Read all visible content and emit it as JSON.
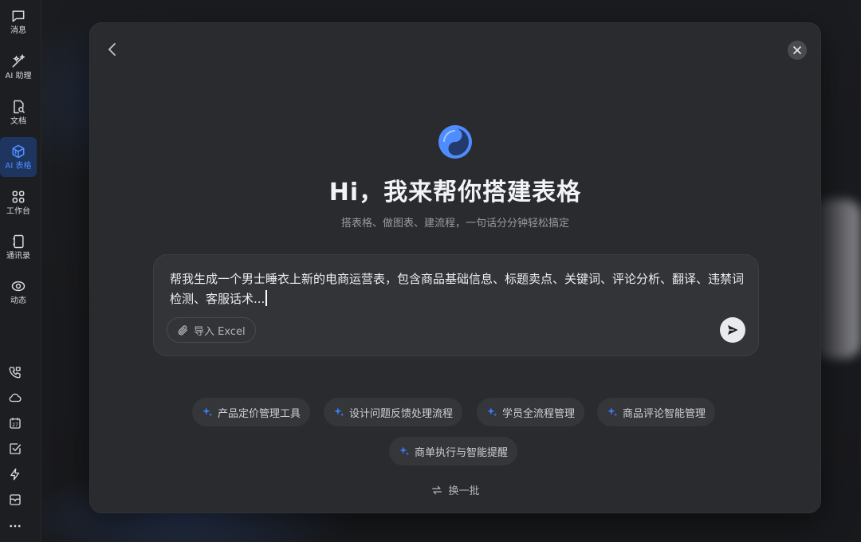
{
  "sidebar": {
    "items": [
      {
        "label": "消息",
        "icon": "chat-bubble-icon"
      },
      {
        "label": "AI 助理",
        "icon": "ai-sparkle-icon"
      },
      {
        "label": "文档",
        "icon": "document-search-icon"
      },
      {
        "label": "AI 表格",
        "icon": "cube-table-icon",
        "active": true
      },
      {
        "label": "工作台",
        "icon": "grid-apps-icon"
      },
      {
        "label": "通讯录",
        "icon": "contacts-book-icon"
      },
      {
        "label": "动态",
        "icon": "eye-ring-icon"
      }
    ],
    "tools": [
      "phone-call-icon",
      "cloud-icon",
      "calendar-icon",
      "checkbox-icon",
      "lightning-icon",
      "panel-icon",
      "more-icon"
    ],
    "calendar_day": "27"
  },
  "modal": {
    "title": "Hi，我来帮你搭建表格",
    "subtitle": "搭表格、做图表、建流程，一句话分分钟轻松搞定",
    "prompt": {
      "text": "帮我生成一个男士睡衣上新的电商运营表，包含商品基础信息、标题卖点、关键词、评论分析、翻译、违禁词检测、客服话术...",
      "import_label": "导入 Excel"
    },
    "suggestions": [
      "产品定价管理工具",
      "设计问题反馈处理流程",
      "学员全流程管理",
      "商品评论智能管理",
      "商单执行与智能提醒"
    ],
    "refresh_label": "换一批"
  },
  "colors": {
    "accent": "#4f8dff",
    "modal_bg": "#2a2b2f",
    "sparkle": "#3b7bf6"
  }
}
